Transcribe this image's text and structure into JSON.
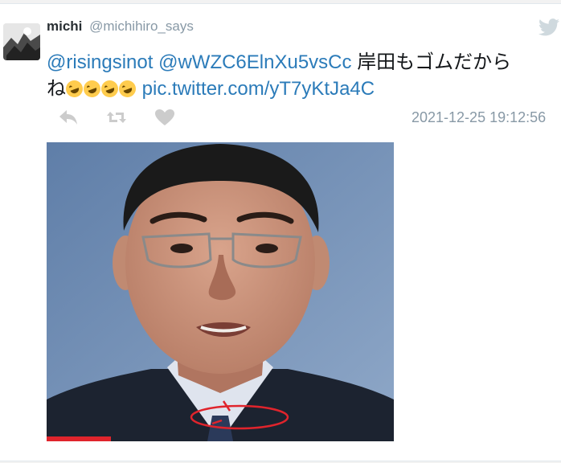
{
  "tweet": {
    "display_name": "michi",
    "handle": "@michihiro_says",
    "mention_1": "@risingsinot",
    "mention_2": "@wWZC6ElnXu5vsCc",
    "text_jp": "岸田もゴムだから",
    "text_jp_2": "ね",
    "emoji_name": "rolling-on-the-floor-laughing",
    "emoji_count": 4,
    "pic_link": "pic.twitter.com/yT7yKtJa4C",
    "timestamp": "2021-12-25 19:12:56"
  },
  "icons": {
    "bird": "twitter-bird-icon",
    "reply": "reply-icon",
    "retweet": "retweet-icon",
    "like": "heart-icon"
  },
  "colors": {
    "link": "#2b7bb9",
    "muted": "#8899a6",
    "icon_grey": "#cccccc",
    "annotation_red": "#e0242c"
  }
}
